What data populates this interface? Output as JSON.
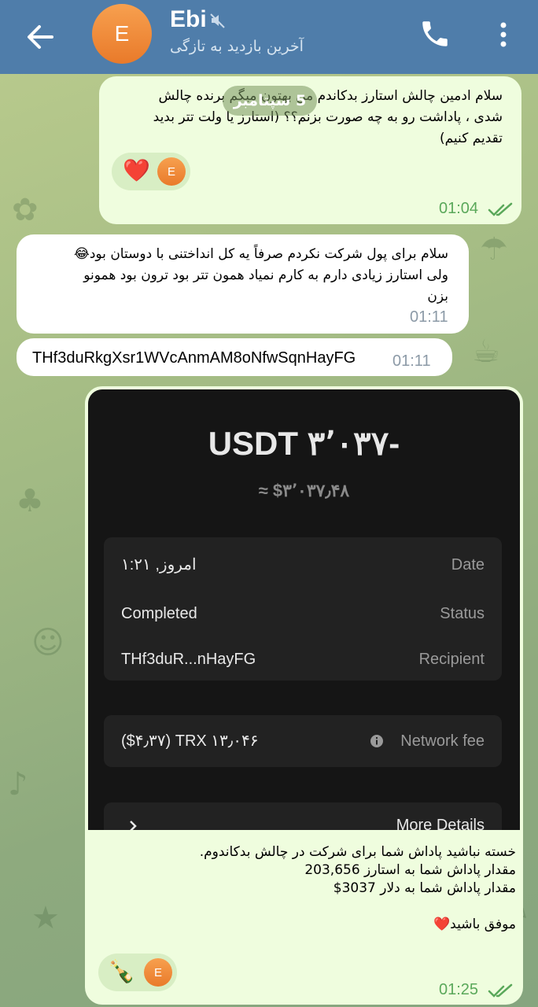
{
  "header": {
    "avatar_letter": "E",
    "title": "Ebi",
    "subtitle": "آخرین بازدید به تازگی"
  },
  "date_chip": "5 سپتامبر",
  "messages": {
    "m1": {
      "line1": "سلام ادمین چالش استارز بدکاندم من بهتون میگم برنده چالش",
      "line2": "شدی ، پاداشت رو به چه صورت بزنم؟؟ (استارز یا ولت تتر بدید",
      "line3": "تقدیم کنیم)",
      "reaction_emoji": "❤️",
      "reaction_avatar": "E",
      "time": "01:04"
    },
    "m2": {
      "line1": "سلام برای پول شرکت نکردم صرفاً یه کل انداختنی با دوستان بود😂",
      "line2": "ولی استارز زیادی دارم به کارم نمیاد همون تتر بود ترون بود همونو",
      "line3": "بزن",
      "time": "01:11"
    },
    "m3": {
      "text": "THf3duRkgXsr1WVcAnmAM8oNfwSqnHayFG",
      "time": "01:11"
    },
    "m4": {
      "shot": {
        "amount": "USDT ۳٬۰۳۷-",
        "usd": "≈ $۳٬۰۳۷٫۴۸",
        "date_label": "Date",
        "date_value": "امروز, ۱:۲۱",
        "status_label": "Status",
        "status_value": "Completed",
        "recipient_label": "Recipient",
        "recipient_value": "THf3duR...nHayFG",
        "fee_label": "Network fee",
        "fee_value": "($۴٫۳۷) TRX ۱۳٫۰۴۶",
        "more_label": "More Details"
      },
      "line1": "خسته نباشید پاداش شما برای شرکت در چالش بدکاندوم.",
      "line2": "مقدار پاداش شما به استارز 203,656",
      "line3": "مقدار پاداش شما به دلار 3037$",
      "line4": "موفق باشید❤️",
      "reaction_emoji": "🍾",
      "reaction_avatar": "E",
      "time": "01:25"
    }
  },
  "colors": {
    "header_bg": "#4f7daa",
    "outgoing_bubble": "#effdde",
    "incoming_bubble": "#ffffff",
    "outgoing_time": "#5aa85a"
  }
}
